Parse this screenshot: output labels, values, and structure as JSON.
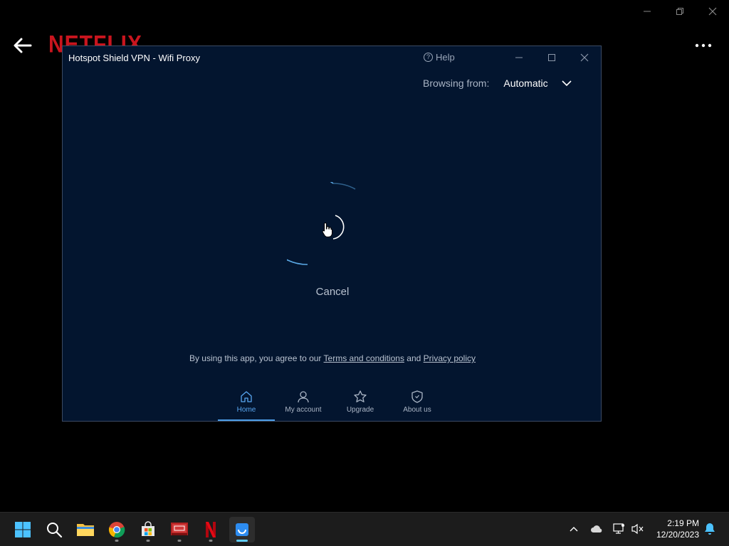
{
  "background_app": {
    "logo": "NETFLIX",
    "back_icon": "arrow-left-icon",
    "more_icon": "ellipsis-icon"
  },
  "vpn": {
    "title": "Hotspot Shield VPN - Wifi Proxy",
    "help_label": "Help",
    "browsing_from_label": "Browsing from:",
    "browsing_from_value": "Automatic",
    "cancel_label": "Cancel",
    "terms": {
      "prefix": "By using this app, you agree to our",
      "terms_link": "Terms and conditions",
      "and": "and",
      "privacy_link": "Privacy policy"
    },
    "nav": [
      {
        "label": "Home",
        "icon": "home-icon",
        "active": true
      },
      {
        "label": "My account",
        "icon": "user-icon",
        "active": false
      },
      {
        "label": "Upgrade",
        "icon": "star-icon",
        "active": false
      },
      {
        "label": "About us",
        "icon": "shield-icon",
        "active": false
      }
    ],
    "colors": {
      "background": "#03152f",
      "accent": "#4d9de6"
    }
  },
  "taskbar": {
    "apps": [
      "start",
      "search",
      "file-explorer",
      "chrome",
      "microsoft-store",
      "remote-desktop",
      "netflix",
      "hotspot-shield"
    ],
    "time": "2:19 PM",
    "date": "12/20/2023"
  }
}
